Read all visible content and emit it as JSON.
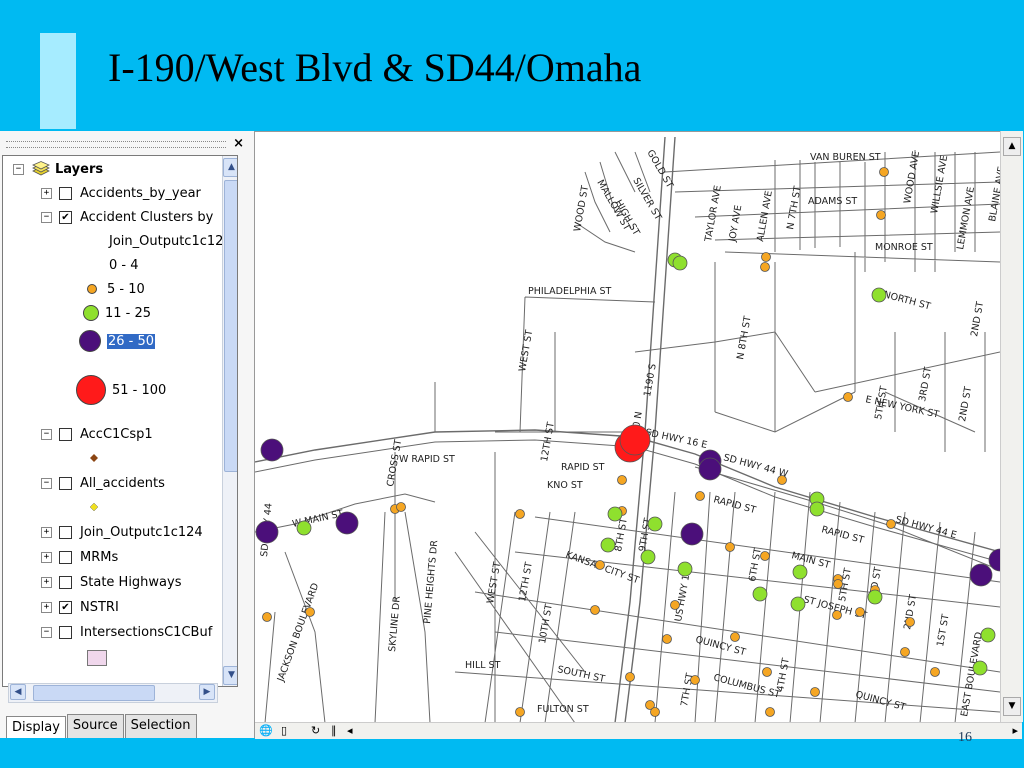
{
  "slide": {
    "title": "I-190/West Blvd & SD44/Omaha",
    "page_number": "16"
  },
  "toc": {
    "close_label": "×",
    "tabs": [
      "Display",
      "Source",
      "Selection"
    ],
    "root": "Layers",
    "items": [
      {
        "expander": "+",
        "checked": false,
        "label": "Accidents_by_year"
      },
      {
        "expander": "−",
        "checked": true,
        "label": "Accident Clusters by"
      },
      {
        "sub": "Join_Outputc1c12"
      },
      {
        "legend": "0 - 4"
      },
      {
        "legend": "5 - 10"
      },
      {
        "legend": "11 - 25"
      },
      {
        "legend": "26 - 50"
      },
      {
        "legend": "51 - 100"
      },
      {
        "expander": "−",
        "checked": false,
        "label": "AccC1Csp1"
      },
      {
        "expander": "−",
        "checked": false,
        "label": "All_accidents"
      },
      {
        "expander": "+",
        "checked": false,
        "label": "Join_Outputc1c124"
      },
      {
        "expander": "+",
        "checked": false,
        "label": "MRMs"
      },
      {
        "expander": "+",
        "checked": false,
        "label": "State Highways"
      },
      {
        "expander": "+",
        "checked": true,
        "label": "NSTRI"
      },
      {
        "expander": "−",
        "checked": false,
        "label": "IntersectionsC1CBuf"
      }
    ]
  },
  "legend_colors": {
    "c5_10": "#f5a623",
    "c11_25": "#8fe02e",
    "c26_50": "#4b0f7a",
    "c51_100": "#ff1a1a",
    "acc": "#8b4513",
    "all": "#f0e020",
    "buffer": "#f0d7ec"
  },
  "map": {
    "street_labels": [
      "VAN BUREN ST",
      "ADAMS ST",
      "MONROE ST",
      "NORTH ST",
      "PHILADELPHIA ST",
      "WOOD ST",
      "MALLOW ST",
      "HIGH ST",
      "SILVER ST",
      "GOLD ST",
      "TAYLOR AVE",
      "JOY AVE",
      "ALLEN AVE",
      "N 7TH ST",
      "WOOD AVE",
      "WILLSIE AVE",
      "LEMMON AVE",
      "BLAINE AVE",
      "N 8TH ST",
      "WEST ST",
      "1190 S",
      "190 N",
      "5TH ST",
      "3RD ST",
      "2ND ST",
      "2ND ST",
      "E NEW YORK ST",
      "SD HWY 16 E",
      "SD HWY 44 W",
      "SD HWY 44 E",
      "RAPID ST",
      "RAPID ST",
      "RAPID ST",
      "KNO ST",
      "W RAPID ST",
      "12TH ST",
      "CROSS ST",
      "W MAIN ST",
      "SD HWY 44",
      "JACKSON BOULEVARD",
      "SKYLINE DR",
      "PINE HEIGHTS DR",
      "WEST ST",
      "12TH ST",
      "10TH ST",
      "KANSAS CITY ST",
      "9TH ST",
      "US HWY 16",
      "6TH ST",
      "MAIN ST",
      "ST JOSEPH ST",
      "5TH ST",
      "3RD ST",
      "2ND ST",
      "1ST ST",
      "QUINCY ST",
      "COLUMBUS ST",
      "QUINCY ST",
      "7TH ST",
      "4TH ST",
      "EAST BOULEVARD",
      "HILL ST",
      "SOUTH ST",
      "FULTON ST",
      "8TH ST"
    ]
  }
}
